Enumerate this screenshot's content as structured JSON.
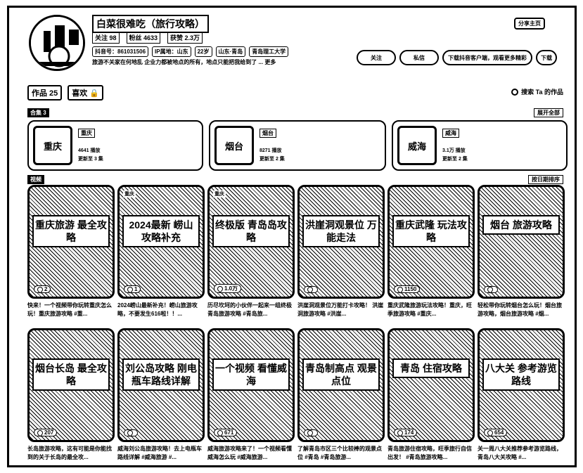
{
  "profile": {
    "name": "白菜很难吃（旅行攻略）",
    "stats": [
      "关注 98",
      "粉丝 4633",
      "获赞 2.3万"
    ],
    "ids": [
      "抖音号：861031506",
      "IP属地：山东",
      "22岁",
      "山东·青岛",
      "青岛理工大学"
    ],
    "bio": "旅游不关家在何地乱 企业力都被地点的所有，地点只能把我给到了 ... 更多",
    "share": "分享主页",
    "actions": [
      "关注",
      "私信",
      "下载抖音客户端，观看更多精彩",
      "下载"
    ]
  },
  "tabs": {
    "works": "作品 25",
    "likes": "喜欢 🔒"
  },
  "search_works": "搜索 Ta 的作品",
  "collections_label": "合集 3",
  "collections_sort": "展开全部",
  "collections": [
    {
      "thumb": "重庆",
      "title": "重庆",
      "plays": "4641 播放",
      "updated": "更新至 3 集"
    },
    {
      "thumb": "烟台",
      "title": "烟台",
      "plays": "8271 播放",
      "updated": "更新至 2 集"
    },
    {
      "thumb": "威海",
      "title": "威海",
      "plays": "3.1万 播放",
      "updated": "更新至 2 集"
    }
  ],
  "videos_label": "视频",
  "videos_sort": "按日期排序",
  "videos": [
    {
      "cover": "重庆旅游 最全攻略",
      "loc": "",
      "likes": "2",
      "caption": "快来！一个视频带你玩转重庆怎么玩！重庆旅游攻略 #重..."
    },
    {
      "cover": "2024最新 崂山攻略补充",
      "loc": "重庆",
      "likes": "1",
      "caption": "2024崂山最新补充！崂山旅游攻略，不要发生616啦！！..."
    },
    {
      "cover": "终极版 青岛岛攻略",
      "loc": "重庆",
      "likes": "1.0万",
      "caption": "历尽坎坷的小伙伴一起来一组终极青岛旅游攻略 #青岛旅..."
    },
    {
      "cover": "洪崖洞观景位 万能走法",
      "loc": "",
      "likes": "",
      "caption": "洪崖洞观景位万能打卡攻略！ 洪崖洞旅游攻略 #洪崖..."
    },
    {
      "cover": "重庆武隆 玩法攻略",
      "loc": "",
      "likes": "1150",
      "caption": "重庆武隆旅游玩法攻略！重庆，旺季旅游攻略 #重庆..."
    },
    {
      "cover": "烟台 旅游攻略",
      "loc": "",
      "likes": "",
      "caption": "轻松带你玩转烟台怎么玩！烟台旅游攻略，烟台旅游攻略 #烟..."
    },
    {
      "cover": "烟台长岛 最全攻略",
      "loc": "",
      "likes": "207",
      "caption": "长岛旅游攻略，这有可能是你能找到的关于长岛的最全攻..."
    },
    {
      "cover": "刘公岛攻略 刚电瓶车路线详解",
      "loc": "",
      "likes": "",
      "caption": "威海刘公岛旅游攻略！去上电瓶车路线详解 #威海旅游 #..."
    },
    {
      "cover": "一个视频 看懂威海",
      "loc": "",
      "likes": "671",
      "caption": "威海旅游攻略来了！一个视频看懂威海怎么玩 #威海旅游..."
    },
    {
      "cover": "青岛制高点 观景点位",
      "loc": "",
      "likes": "",
      "caption": "了解青岛市区三个比较棒的观景点位 #青岛 #青岛旅游..."
    },
    {
      "cover": "青岛 住宿攻略",
      "loc": "",
      "likes": "174",
      "caption": "青岛旅游住宿攻略，旺季旅行自信出发！ #青岛旅游攻略..."
    },
    {
      "cover": "八大关 参考游览路线",
      "loc": "",
      "likes": "654",
      "caption": "关一周八大关推荐参考游览路线，青岛八大关攻略 #..."
    }
  ]
}
